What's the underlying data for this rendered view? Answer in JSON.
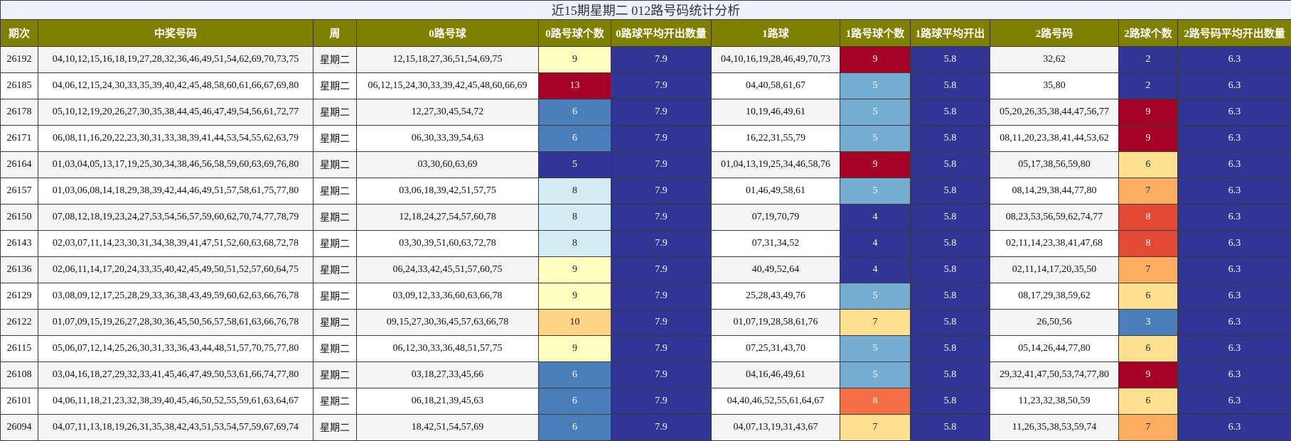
{
  "title": "近15期星期二 012路号码统计分析",
  "headers": [
    "期次",
    "中奖号码",
    "周",
    "0路号球",
    "0路号球个数",
    "0路球平均开出数量",
    "1路球",
    "1路号球个数",
    "1路球平均开出",
    "2路号码",
    "2路球个数",
    "2路号码平均开出数量"
  ],
  "colors": {
    "header_bg": "#808000",
    "avg_bg": "#313695",
    "count_scale": {
      "2": "#313695",
      "3": "#4a7ebb",
      "4": "#313695",
      "5": "#74add1",
      "6": "#4a7ebb",
      "7": "#fee090",
      "8": "#abd9e9",
      "9": "#ffffbf",
      "10": "#fdd080",
      "13": "#a50026"
    }
  },
  "chart_data": {
    "type": "table",
    "title": "近15期星期二 012路号码统计分析",
    "columns": [
      "期次",
      "中奖号码",
      "周",
      "0路号球",
      "0路号球个数",
      "0路球平均开出数量",
      "1路球",
      "1路号球个数",
      "1路球平均开出",
      "2路号码",
      "2路球个数",
      "2路号码平均开出数量"
    ],
    "rows": [
      {
        "issue": "26192",
        "numbers": "04,10,12,15,16,18,19,27,28,32,36,46,49,51,54,62,69,70,73,75",
        "week": "星期二",
        "r0": "12,15,18,27,36,51,54,69,75",
        "c0": 9,
        "a0": "7.9",
        "r1": "04,10,16,19,28,46,49,70,73",
        "c1": 9,
        "a1": "5.8",
        "r2": "32,62",
        "c2": 2,
        "a2": "6.3"
      },
      {
        "issue": "26185",
        "numbers": "04,06,12,15,24,30,33,35,39,40,42,45,48,58,60,61,66,67,69,80",
        "week": "星期二",
        "r0": "06,12,15,24,30,33,39,42,45,48,60,66,69",
        "c0": 13,
        "a0": "7.9",
        "r1": "04,40,58,61,67",
        "c1": 5,
        "a1": "5.8",
        "r2": "35,80",
        "c2": 2,
        "a2": "6.3"
      },
      {
        "issue": "26178",
        "numbers": "05,10,12,19,20,26,27,30,35,38,44,45,46,47,49,54,56,61,72,77",
        "week": "星期二",
        "r0": "12,27,30,45,54,72",
        "c0": 6,
        "a0": "7.9",
        "r1": "10,19,46,49,61",
        "c1": 5,
        "a1": "5.8",
        "r2": "05,20,26,35,38,44,47,56,77",
        "c2": 9,
        "a2": "6.3"
      },
      {
        "issue": "26171",
        "numbers": "06,08,11,16,20,22,23,30,31,33,38,39,41,44,53,54,55,62,63,79",
        "week": "星期二",
        "r0": "06,30,33,39,54,63",
        "c0": 6,
        "a0": "7.9",
        "r1": "16,22,31,55,79",
        "c1": 5,
        "a1": "5.8",
        "r2": "08,11,20,23,38,41,44,53,62",
        "c2": 9,
        "a2": "6.3"
      },
      {
        "issue": "26164",
        "numbers": "01,03,04,05,13,17,19,25,30,34,38,46,56,58,59,60,63,69,76,80",
        "week": "星期二",
        "r0": "03,30,60,63,69",
        "c0": 5,
        "a0": "7.9",
        "r1": "01,04,13,19,25,34,46,58,76",
        "c1": 9,
        "a1": "5.8",
        "r2": "05,17,38,56,59,80",
        "c2": 6,
        "a2": "6.3"
      },
      {
        "issue": "26157",
        "numbers": "01,03,06,08,14,18,29,38,39,42,44,46,49,51,57,58,61,75,77,80",
        "week": "星期二",
        "r0": "03,06,18,39,42,51,57,75",
        "c0": 8,
        "a0": "7.9",
        "r1": "01,46,49,58,61",
        "c1": 5,
        "a1": "5.8",
        "r2": "08,14,29,38,44,77,80",
        "c2": 7,
        "a2": "6.3"
      },
      {
        "issue": "26150",
        "numbers": "07,08,12,18,19,23,24,27,53,54,56,57,59,60,62,70,74,77,78,79",
        "week": "星期二",
        "r0": "12,18,24,27,54,57,60,78",
        "c0": 8,
        "a0": "7.9",
        "r1": "07,19,70,79",
        "c1": 4,
        "a1": "5.8",
        "r2": "08,23,53,56,59,62,74,77",
        "c2": 8,
        "a2": "6.3"
      },
      {
        "issue": "26143",
        "numbers": "02,03,07,11,14,23,30,31,34,38,39,41,47,51,52,60,63,68,72,78",
        "week": "星期二",
        "r0": "03,30,39,51,60,63,72,78",
        "c0": 8,
        "a0": "7.9",
        "r1": "07,31,34,52",
        "c1": 4,
        "a1": "5.8",
        "r2": "02,11,14,23,38,41,47,68",
        "c2": 8,
        "a2": "6.3"
      },
      {
        "issue": "26136",
        "numbers": "02,06,11,14,17,20,24,33,35,40,42,45,49,50,51,52,57,60,64,75",
        "week": "星期二",
        "r0": "06,24,33,42,45,51,57,60,75",
        "c0": 9,
        "a0": "7.9",
        "r1": "40,49,52,64",
        "c1": 4,
        "a1": "5.8",
        "r2": "02,11,14,17,20,35,50",
        "c2": 7,
        "a2": "6.3"
      },
      {
        "issue": "26129",
        "numbers": "03,08,09,12,17,25,28,29,33,36,38,43,49,59,60,62,63,66,76,78",
        "week": "星期二",
        "r0": "03,09,12,33,36,60,63,66,78",
        "c0": 9,
        "a0": "7.9",
        "r1": "25,28,43,49,76",
        "c1": 5,
        "a1": "5.8",
        "r2": "08,17,29,38,59,62",
        "c2": 6,
        "a2": "6.3"
      },
      {
        "issue": "26122",
        "numbers": "01,07,09,15,19,26,27,28,30,36,45,50,56,57,58,61,63,66,76,78",
        "week": "星期二",
        "r0": "09,15,27,30,36,45,57,63,66,78",
        "c0": 10,
        "a0": "7.9",
        "r1": "01,07,19,28,58,61,76",
        "c1": 7,
        "a1": "5.8",
        "r2": "26,50,56",
        "c2": 3,
        "a2": "6.3"
      },
      {
        "issue": "26115",
        "numbers": "05,06,07,12,14,25,26,30,31,33,36,43,44,48,51,57,70,75,77,80",
        "week": "星期二",
        "r0": "06,12,30,33,36,48,51,57,75",
        "c0": 9,
        "a0": "7.9",
        "r1": "07,25,31,43,70",
        "c1": 5,
        "a1": "5.8",
        "r2": "05,14,26,44,77,80",
        "c2": 6,
        "a2": "6.3"
      },
      {
        "issue": "26108",
        "numbers": "03,04,16,18,27,29,32,33,41,45,46,47,49,50,53,61,66,74,77,80",
        "week": "星期二",
        "r0": "03,18,27,33,45,66",
        "c0": 6,
        "a0": "7.9",
        "r1": "04,16,46,49,61",
        "c1": 5,
        "a1": "5.8",
        "r2": "29,32,41,47,50,53,74,77,80",
        "c2": 9,
        "a2": "6.3"
      },
      {
        "issue": "26101",
        "numbers": "04,06,11,18,21,23,32,38,39,40,45,46,50,52,55,59,61,63,64,67",
        "week": "星期二",
        "r0": "06,18,21,39,45,63",
        "c0": 6,
        "a0": "7.9",
        "r1": "04,40,46,52,55,61,64,67",
        "c1": 8,
        "a1": "5.8",
        "r2": "11,23,32,38,50,59",
        "c2": 6,
        "a2": "6.3"
      },
      {
        "issue": "26094",
        "numbers": "04,07,11,13,18,19,26,31,35,38,42,43,51,53,54,57,59,67,69,74",
        "week": "星期二",
        "r0": "18,42,51,54,57,69",
        "c0": 6,
        "a0": "7.9",
        "r1": "04,07,13,19,31,43,67",
        "c1": 7,
        "a1": "5.8",
        "r2": "11,26,35,38,53,59,74",
        "c2": 7,
        "a2": "6.3"
      }
    ]
  }
}
